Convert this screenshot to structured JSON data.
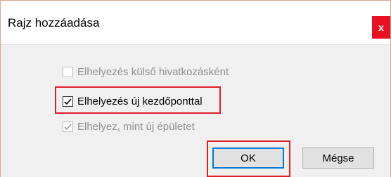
{
  "dialog": {
    "title": "Rajz hozzáadása",
    "close_label": "x"
  },
  "options": [
    {
      "label": "Elhelyezés külső hivatkozásként",
      "checked": false,
      "enabled": false
    },
    {
      "label": "Elhelyezés új kezdőponttal",
      "checked": true,
      "enabled": true
    },
    {
      "label": "Elhelyez, mint új épületet",
      "checked": true,
      "enabled": false
    }
  ],
  "buttons": {
    "ok_label": "OK",
    "cancel_label": "Mégse"
  },
  "colors": {
    "highlight": "#e01e2a",
    "close_button": "#e81123",
    "focus_border": "#0078d7"
  }
}
